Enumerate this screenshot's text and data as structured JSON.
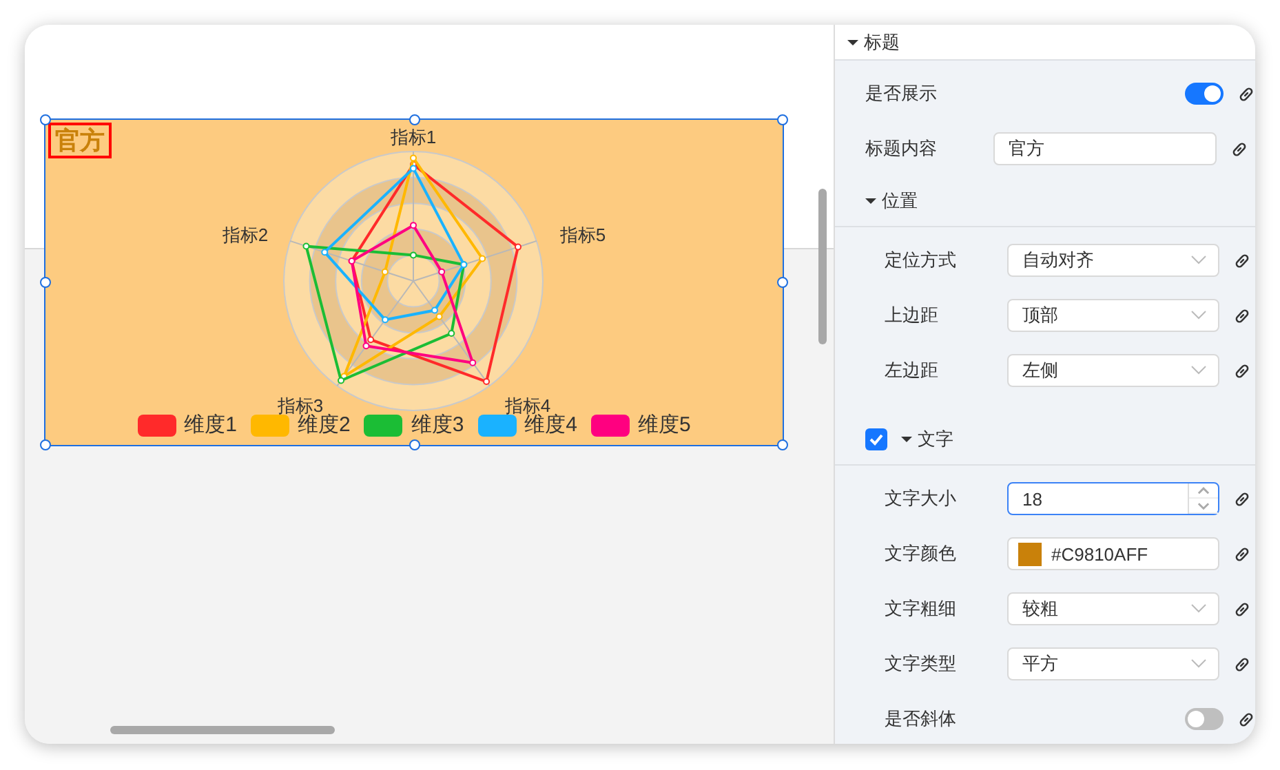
{
  "canvas": {
    "chart": {
      "title": "官方",
      "selected": true,
      "indicators": [
        "指标1",
        "指标2",
        "指标3",
        "指标4",
        "指标5"
      ],
      "legend": [
        {
          "name": "维度1",
          "color": "#ff2a2a"
        },
        {
          "name": "维度2",
          "color": "#ffb800"
        },
        {
          "name": "维度3",
          "color": "#1bbd35"
        },
        {
          "name": "维度4",
          "color": "#1ab2ff"
        },
        {
          "name": "维度5",
          "color": "#ff0080"
        }
      ]
    }
  },
  "panel": {
    "sections": [
      {
        "title": "标题",
        "kind": "plain",
        "expanded": true,
        "rows": [
          {
            "kind": "toggle",
            "label": "是否展示",
            "on": true
          },
          {
            "kind": "text",
            "label": "标题内容",
            "value": "官方",
            "focused": false
          }
        ],
        "children": [
          {
            "title": "位置",
            "kind": "plain",
            "expanded": true,
            "rows": [
              {
                "kind": "select",
                "label": "定位方式",
                "value": "自动对齐",
                "focused": false
              },
              {
                "kind": "select",
                "label": "上边距",
                "value": "顶部",
                "focused": false
              },
              {
                "kind": "select",
                "label": "左边距",
                "value": "左侧",
                "focused": false
              }
            ]
          },
          {
            "title": "文字",
            "kind": "checkable",
            "checked": true,
            "expanded": true,
            "rows": [
              {
                "kind": "number",
                "label": "文字大小",
                "value": "18",
                "focused": true
              },
              {
                "kind": "color",
                "label": "文字颜色",
                "value": "#C9810AFF",
                "color": "#c9810a",
                "focused": false
              },
              {
                "kind": "select",
                "label": "文字粗细",
                "value": "较粗",
                "focused": false
              },
              {
                "kind": "select",
                "label": "文字类型",
                "value": "平方",
                "focused": false
              },
              {
                "kind": "toggle",
                "label": "是否斜体",
                "on": false
              }
            ]
          }
        ]
      }
    ]
  }
}
